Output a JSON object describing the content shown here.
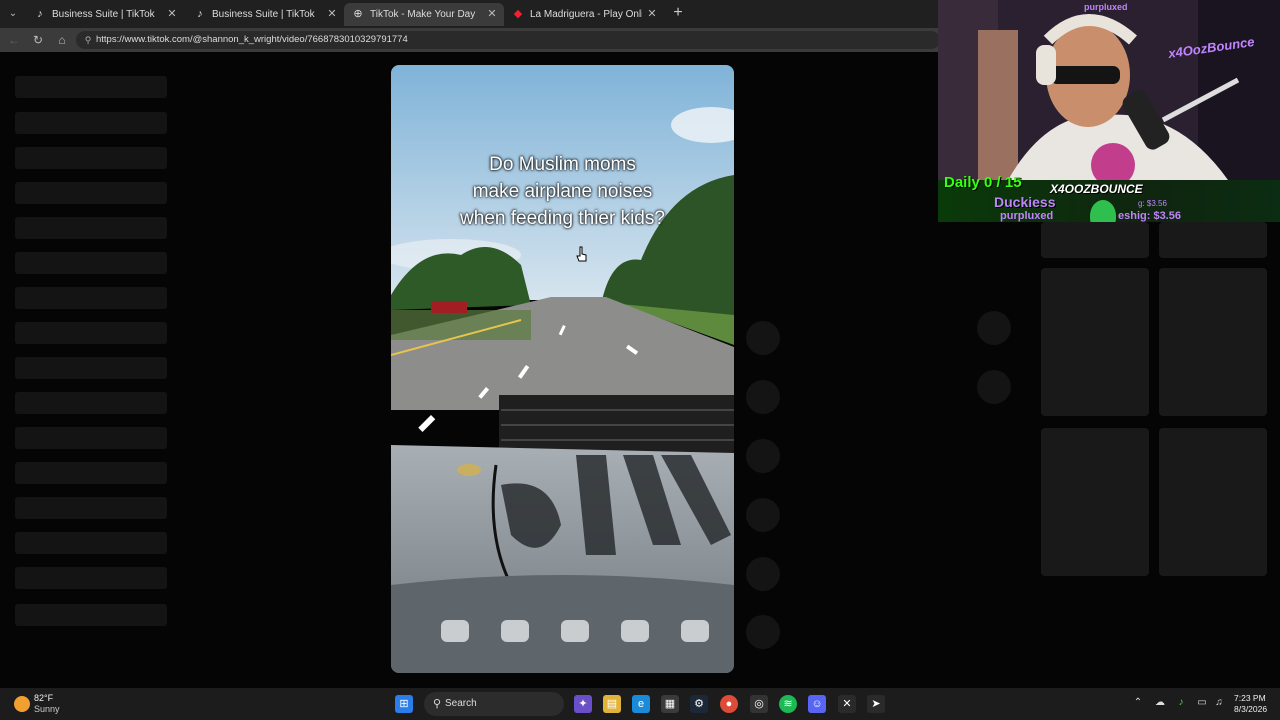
{
  "browser": {
    "tabs": [
      {
        "label": "Business Suite | TikTok",
        "icon": "tiktok-icon"
      },
      {
        "label": "Business Suite | TikTok",
        "icon": "tiktok-icon"
      },
      {
        "label": "TikTok - Make Your Day",
        "icon": "globe-icon",
        "active": true
      },
      {
        "label": "La Madriguera - Play Online With",
        "icon": "game-icon"
      }
    ],
    "new_tab_symbol": "+",
    "url": "https://www.tiktok.com/@shannon_k_wright/video/7668783010329791774"
  },
  "video": {
    "caption_lines": [
      "Do Muslim moms",
      "make airplane noises",
      "when feeding thier kids?"
    ]
  },
  "stream_overlay": {
    "daily": "Daily 0 / 15",
    "streamer": "X4OOZBOUNCE",
    "follower": "Duckiess",
    "brand": "purpluxed",
    "brand_top": "purpluxed",
    "amount": "eshig: $3.56",
    "amount_small": "g: $3.56",
    "logo": "x4OozBounce"
  },
  "taskbar": {
    "weather_temp": "82°F",
    "weather_condition": "Sunny",
    "search_label": "Search",
    "time": "7:23 PM",
    "date": "8/3/2026"
  },
  "colors": {
    "accent_green": "#39ff14",
    "accent_purple": "#c084fc",
    "browser_bg": "#202020"
  }
}
